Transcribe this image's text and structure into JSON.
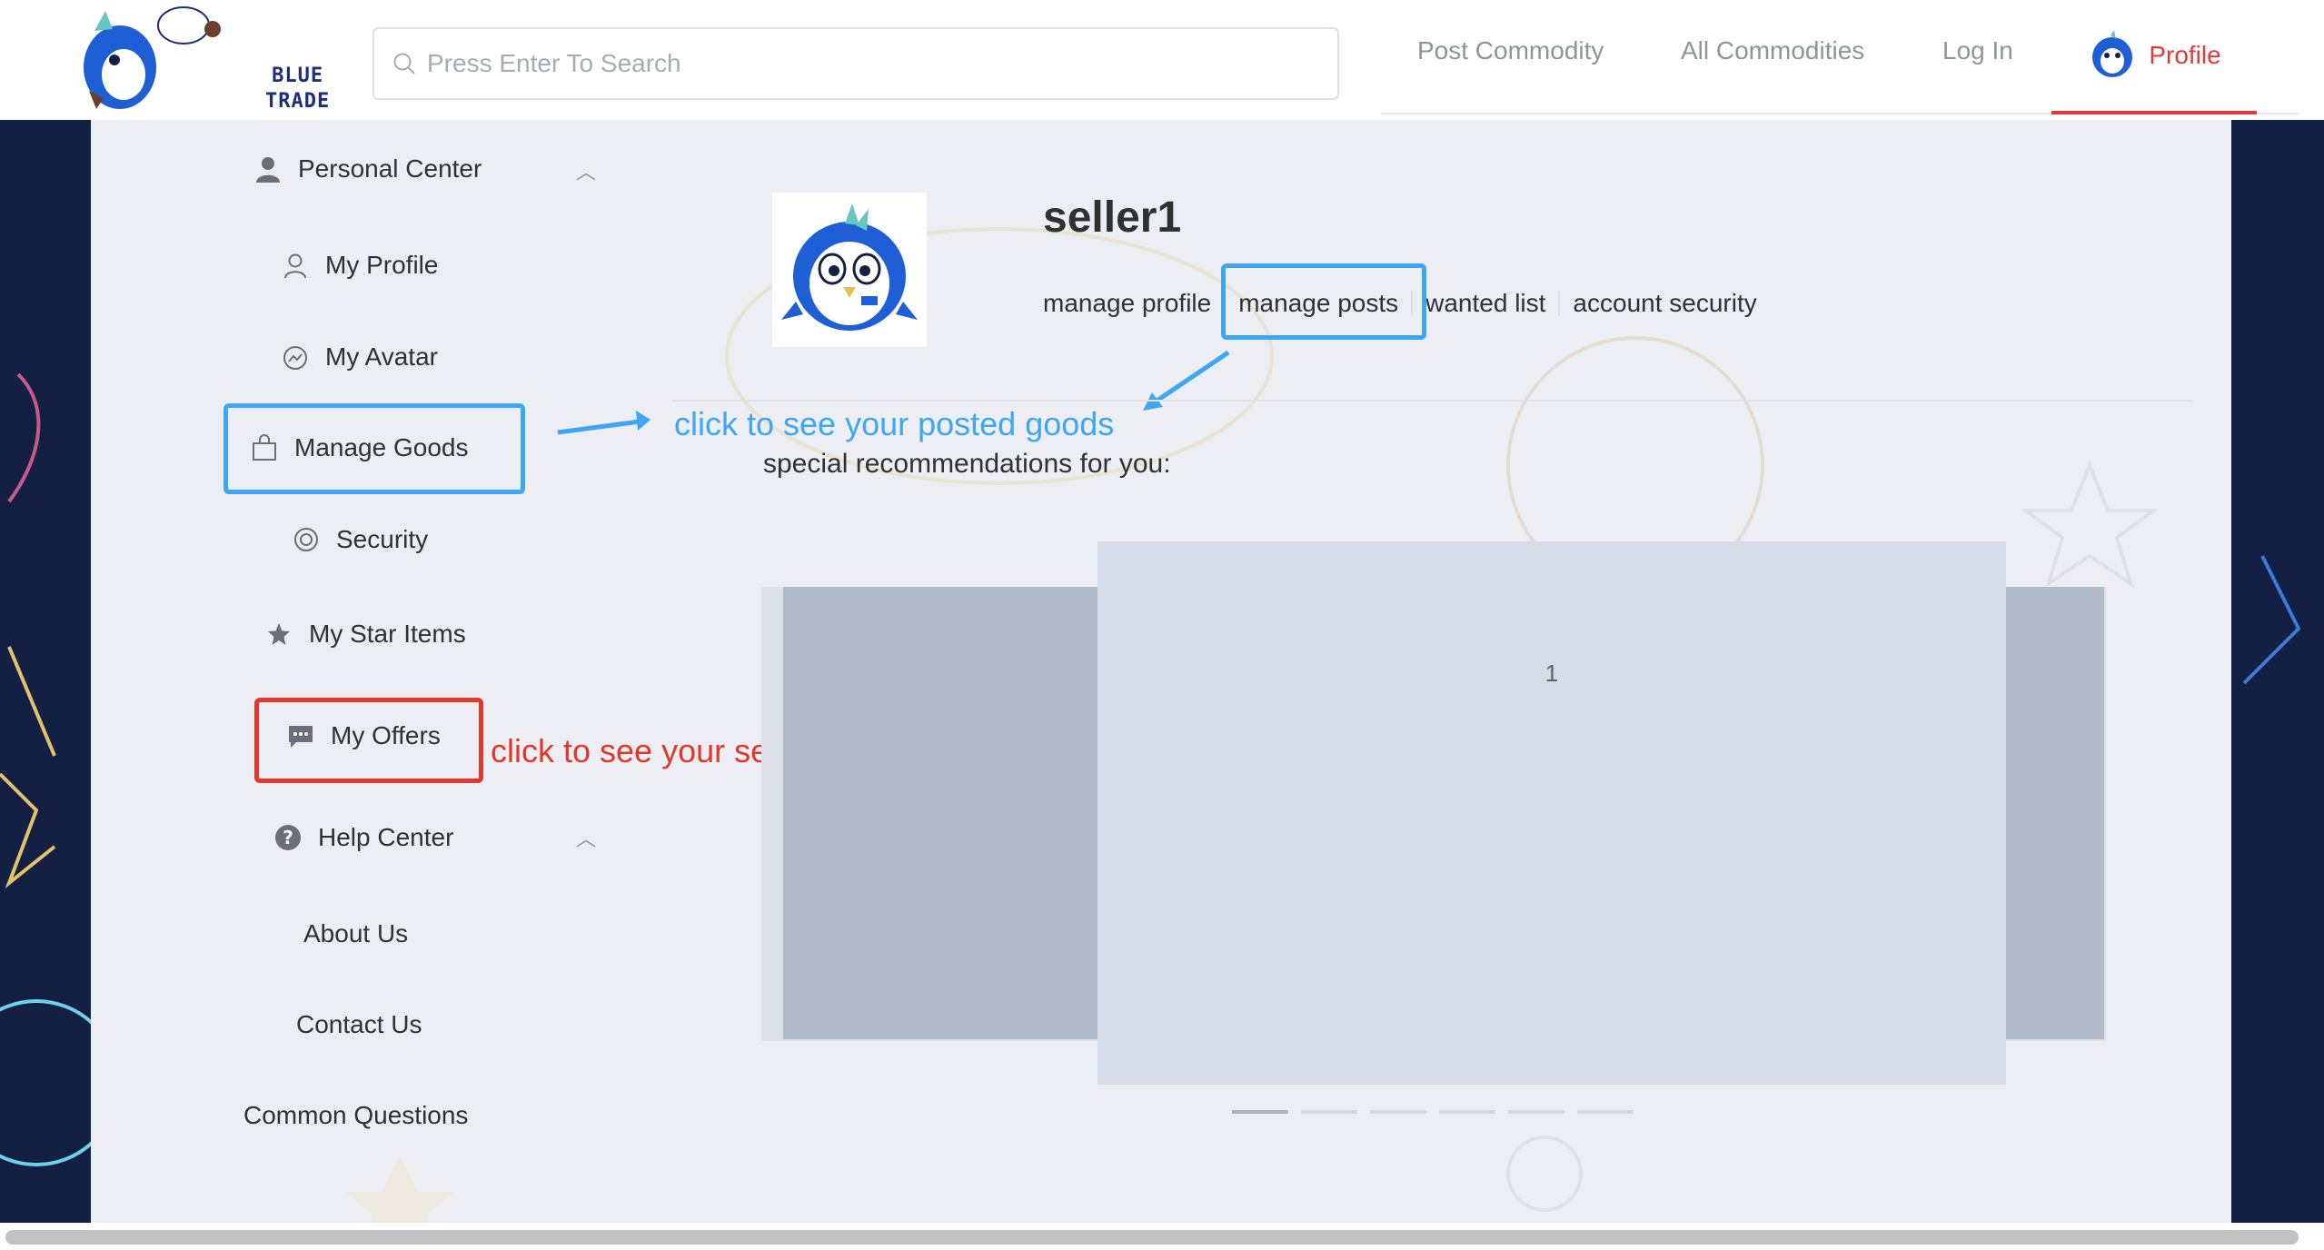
{
  "brand": {
    "logo_text_line1": "BLUE",
    "logo_text_line2": "TRADE"
  },
  "search": {
    "placeholder": "Press Enter To Search"
  },
  "nav": {
    "post_commodity": "Post Commodity",
    "all_commodities": "All Commodities",
    "log_in": "Log In",
    "profile": "Profile"
  },
  "sidebar": {
    "personal_center": "Personal Center",
    "my_profile": "My Profile",
    "my_avatar": "My Avatar",
    "manage_goods": "Manage Goods",
    "security": "Security",
    "my_star_items": "My Star Items",
    "my_offers": "My Offers",
    "help_center": "Help Center",
    "about_us": "About Us",
    "contact_us": "Contact Us",
    "common_questions": "Common Questions"
  },
  "profile": {
    "username": "seller1",
    "tabs": [
      "manage profile",
      "manage posts",
      "wanted list",
      "account security"
    ],
    "recommendations_label": "special recommendations for you:"
  },
  "annotations": {
    "manage_goods_hint": "click to see your posted goods",
    "my_offers_hint": "click to see your selling and buying offers"
  },
  "carousel": {
    "current_slide": "1",
    "slide_count": 6,
    "active_index": 0
  },
  "colors": {
    "accent_red": "#e5383b",
    "annotation_blue": "#3ea6f2",
    "annotation_red": "#e0382b",
    "page_background": "#142043"
  }
}
